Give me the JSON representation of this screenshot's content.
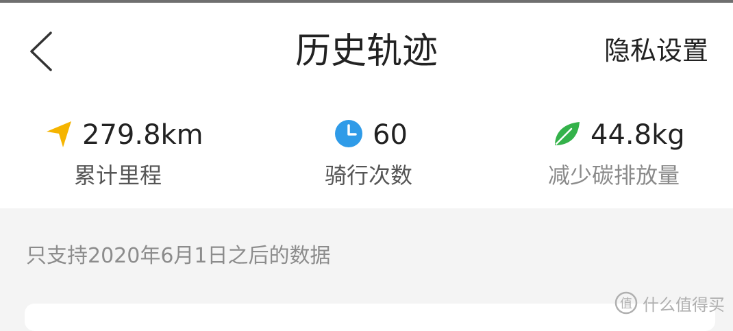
{
  "header": {
    "title": "历史轨迹",
    "privacy_label": "隐私设置"
  },
  "stats": [
    {
      "value": "279.8km",
      "label": "累计里程",
      "icon": "navigation-arrow-icon",
      "color": "#f5b400"
    },
    {
      "value": "60",
      "label": "骑行次数",
      "icon": "clock-icon",
      "color": "#2f9be8"
    },
    {
      "value": "44.8kg",
      "label": "减少碳排放量",
      "icon": "leaf-icon",
      "color": "#34b24a"
    }
  ],
  "note": "只支持2020年6月1日之后的数据",
  "watermark": {
    "text": "什么值得买",
    "symbol": "值"
  }
}
